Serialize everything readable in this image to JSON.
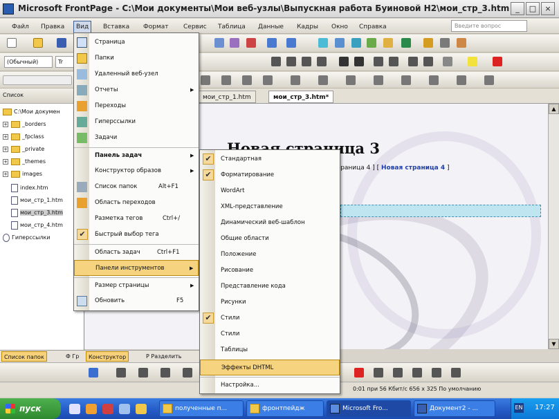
{
  "window": {
    "title": "Microsoft FrontPage - C:\\Мои документы\\Мои веб-узлы\\Выпускная работа Буиновой Н2\\мои_стр_3.htm",
    "controls": [
      "_",
      "□",
      "×"
    ]
  },
  "menubar": {
    "items": [
      "Файл",
      "Правка",
      "Вид",
      "Вставка",
      "Формат",
      "Сервис",
      "Таблица",
      "Данные",
      "Кадры",
      "Окно",
      "Справка"
    ],
    "active": "Вид",
    "ask_placeholder": "Введите вопрос"
  },
  "toolbars": {
    "style_select": "(Обычный)",
    "font_select": "Tr"
  },
  "folder_panel": {
    "header": "Список",
    "tree": [
      {
        "label": "C:\\Мои докумен",
        "type": "root"
      },
      {
        "label": "_borders",
        "type": "folder"
      },
      {
        "label": "_fpclass",
        "type": "folder"
      },
      {
        "label": "_private",
        "type": "folder"
      },
      {
        "label": "_themes",
        "type": "folder"
      },
      {
        "label": "images",
        "type": "folder"
      },
      {
        "label": "index.htm",
        "type": "file"
      },
      {
        "label": "мои_стр_1.htm",
        "type": "file"
      },
      {
        "label": "мои_стр_3.htm",
        "type": "file",
        "selected": true
      },
      {
        "label": "мои_стр_4.htm",
        "type": "file"
      },
      {
        "label": "Гиперссылки",
        "type": "link"
      }
    ]
  },
  "panel_tabs": [
    "Список папок",
    "Ф Гр",
    "Конструктор",
    "Р Разделить"
  ],
  "doc_tabs": [
    "мои_стр_1.htm",
    "мои_стр_3.htm*"
  ],
  "page": {
    "heading": "Новая страница 3",
    "links_prefix": "страница 4 ] [",
    "link_text": "Новая страница 4",
    "links_suffix": "]"
  },
  "view_menu": {
    "items": [
      {
        "label": "Страница",
        "icon": "page-icon"
      },
      {
        "label": "Папки",
        "icon": "folders-icon"
      },
      {
        "label": "Удаленный веб-узел",
        "icon": "remote-site-icon"
      },
      {
        "label": "Отчеты",
        "icon": "reports-icon",
        "arrow": true
      },
      {
        "label": "Переходы",
        "icon": "navigation-icon"
      },
      {
        "label": "Гиперссылки",
        "icon": "hyperlinks-icon"
      },
      {
        "label": "Задачи",
        "icon": "tasks-icon"
      },
      {
        "label": "Панель задач",
        "bold": true,
        "arrow": true,
        "separator": true
      },
      {
        "label": "Конструктор образов",
        "arrow": true
      },
      {
        "label": "Список папок",
        "shortcut": "Alt+F1",
        "icon": "folder-list-icon"
      },
      {
        "label": "Область переходов",
        "icon": "nav-pane-icon"
      },
      {
        "label": "Разметка тегов",
        "shortcut": "Ctrl+/"
      },
      {
        "label": "Быстрый выбор тега",
        "checked": true
      },
      {
        "label": "Область задач",
        "shortcut": "Ctrl+F1",
        "separator": true
      },
      {
        "label": "Панели инструментов",
        "highlighted": true,
        "arrow": true
      },
      {
        "label": "Размер страницы",
        "arrow": true,
        "separator": true
      },
      {
        "label": "Обновить",
        "shortcut": "F5",
        "icon": "refresh-icon"
      }
    ]
  },
  "toolbars_menu": {
    "items": [
      {
        "label": "Стандартная",
        "checked": true
      },
      {
        "label": "Форматирование",
        "checked": true
      },
      {
        "label": "WordArt"
      },
      {
        "label": "XML-представление"
      },
      {
        "label": "Динамический веб-шаблон"
      },
      {
        "label": "Общие области"
      },
      {
        "label": "Положение"
      },
      {
        "label": "Рисование"
      },
      {
        "label": "Представление кода"
      },
      {
        "label": "Рисунки"
      },
      {
        "label": "Стили",
        "checked": true
      },
      {
        "label": "Стили"
      },
      {
        "label": "Таблицы"
      },
      {
        "label": "Эффекты DHTML",
        "highlighted": true
      },
      {
        "label": "Настройка..."
      }
    ]
  },
  "status": {
    "left": "",
    "right": "0:01 при 56 Кбит/с  656 x 325  По умолчанию"
  },
  "taskbar": {
    "start": "пуск",
    "buttons": [
      "полученные п...",
      "фронтпейдж",
      "Microsoft Fro...",
      "Документ2 - ..."
    ],
    "tray_lang": "EN",
    "time": "17:27"
  }
}
